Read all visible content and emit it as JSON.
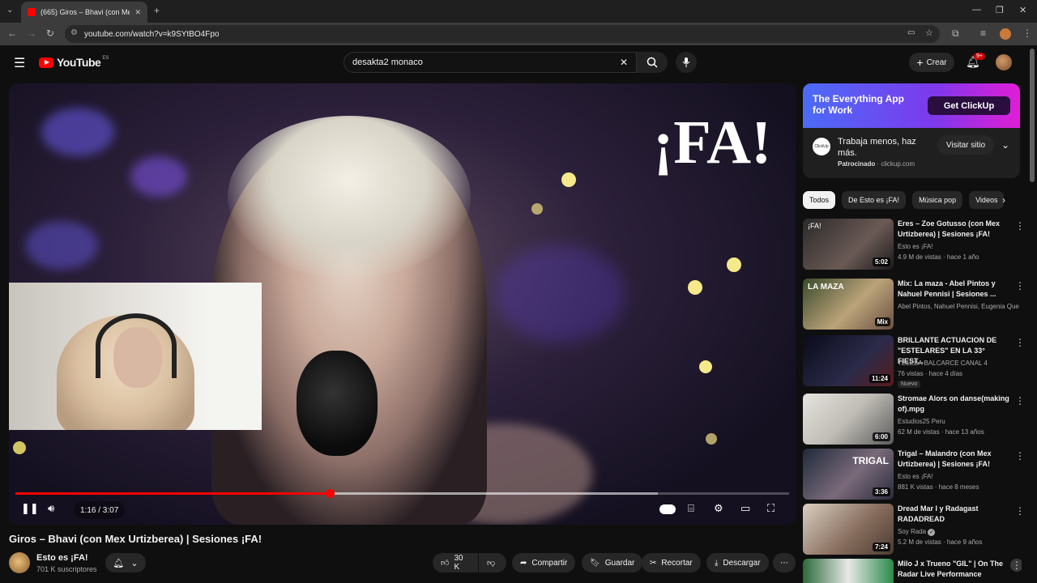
{
  "browser": {
    "tab_title": "(665) Giros – Bhavi (con Me…",
    "url": "youtube.com/watch?v=k9SYtBO4Fpo"
  },
  "header": {
    "logo_text": "YouTube",
    "country": "ES",
    "search_value": "desakta2 monaco",
    "create_label": "Crear",
    "notifications_badge": "9+"
  },
  "player": {
    "overlay_text": "¡FA!",
    "time_label": "1:16 / 3:07",
    "progress": 0.406,
    "buffered": 0.83
  },
  "video": {
    "title": "Giros – Bhavi (con Mex Urtizberea) | Sesiones ¡FA!",
    "channel": "Esto es ¡FA!",
    "subscribers": "701 K suscriptores",
    "likes": "30 K",
    "share_label": "Compartir",
    "save_label": "Guardar",
    "clip_label": "Recortar",
    "download_label": "Descargar"
  },
  "ad": {
    "headline1": "The Everything App",
    "headline2": "for Work",
    "cta": "Get ClickUp",
    "text": "Trabaja menos, haz más.",
    "sponsored": "Patrocinado",
    "domain": "clickup.com",
    "visit_label": "Visitar sitio",
    "logo_text": "ClickUp"
  },
  "chips": [
    "Todos",
    "De Esto es ¡FA!",
    "Música pop",
    "Videos"
  ],
  "recommendations": [
    {
      "title": "Eres – Zoe Gotusso (con Mex Urtizberea) | Sesiones ¡FA!",
      "channel": "Esto es ¡FA!",
      "meta": "4.9 M de vistas · hace 1 año",
      "duration": "5:02",
      "thumb_text": "¡FA!"
    },
    {
      "title": "Mix: La maza - Abel Pintos y Nahuel Pennisi | Sesiones ...",
      "channel": "Abel Pintos, Nahuel Pennisi, Eugenia Que...",
      "meta": "",
      "duration": "Mix",
      "thumb_text": "LA MAZA"
    },
    {
      "title": "BRILLANTE ACTUACION DE \"ESTELARES\" EN LA 33° FIEST...",
      "channel": "TELEBA BALCARCE CANAL 4",
      "meta": "76 vistas · hace 4 días",
      "duration": "11:24",
      "new": "Nuevo"
    },
    {
      "title": "Stromae   Alors on danse(making of).mpg",
      "channel": "Estudios25 Peru",
      "meta": "62 M de vistas · hace 13 años",
      "duration": "6:00"
    },
    {
      "title": "Trigal – Malandro (con Mex Urtizberea) | Sesiones ¡FA!",
      "channel": "Esto es ¡FA!",
      "meta": "881 K vistas · hace 8 meses",
      "duration": "3:36",
      "thumb_text": "TRIGAL"
    },
    {
      "title": "Dread Mar I y Radagast RADADREAD",
      "channel": "Soy Rada",
      "meta": "5.2 M de vistas · hace 9 años",
      "duration": "7:24"
    },
    {
      "title": "Milo J x Trueno \"GIL\" | On The Radar Live Performance",
      "channel": "",
      "meta": "",
      "duration": ""
    }
  ]
}
